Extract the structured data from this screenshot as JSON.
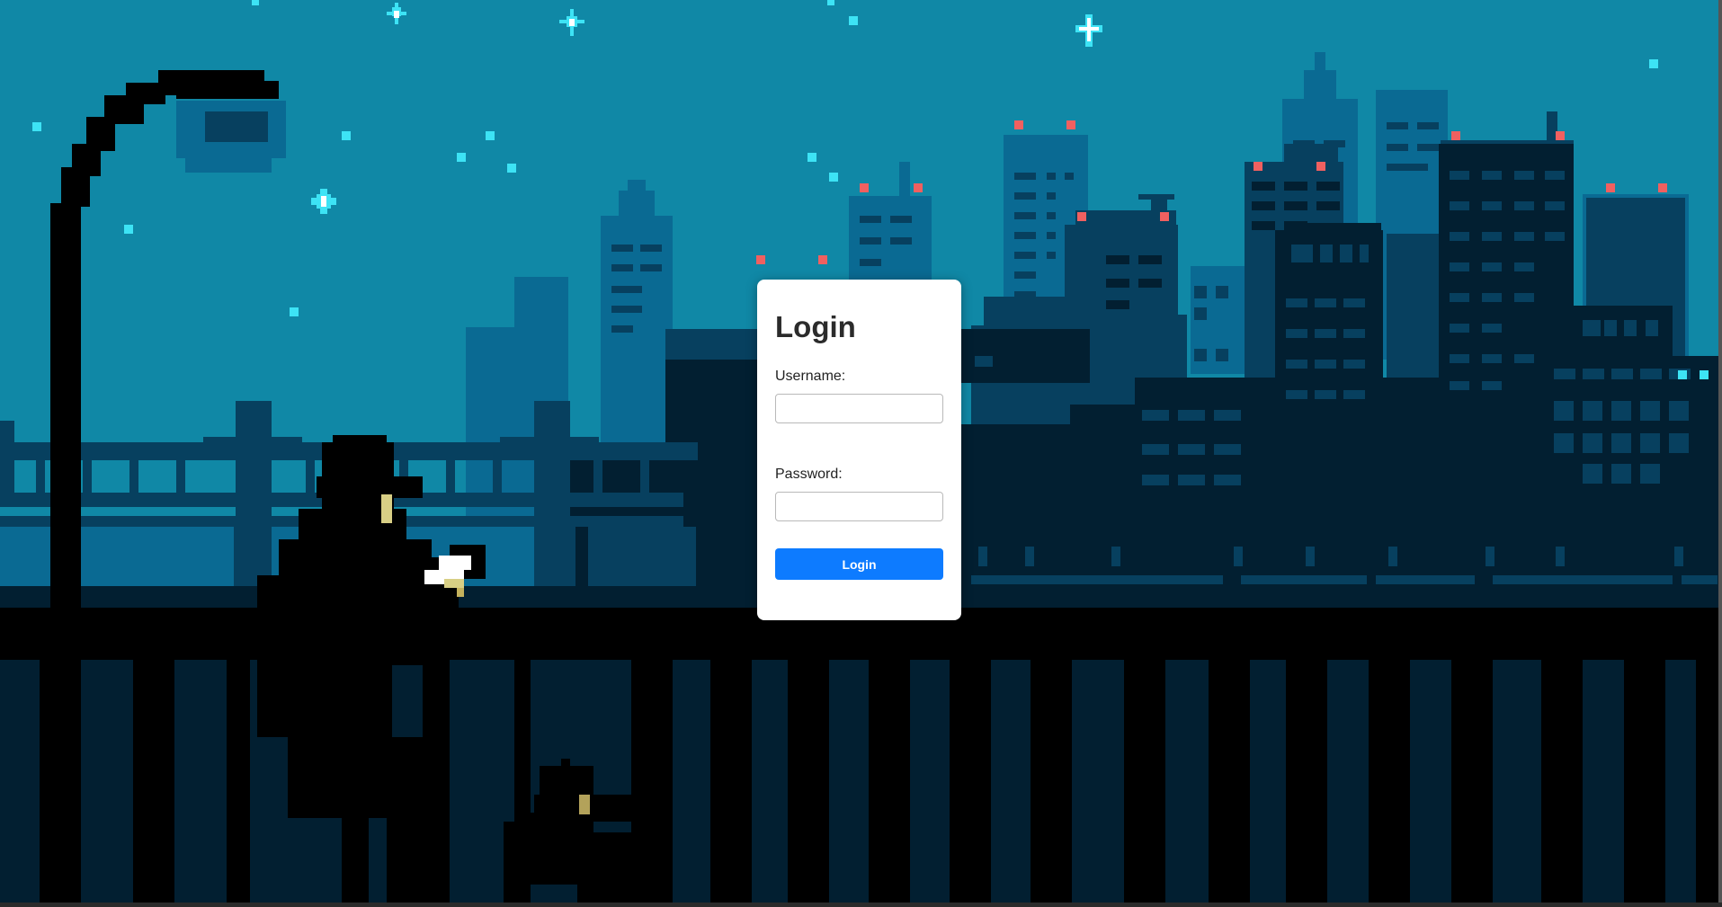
{
  "page": {
    "background_scene": "pixel-art night city skyline with bridge, street lamp, person and dog behind railing"
  },
  "colors": {
    "sky": "#1088a6",
    "building_mid": "#0a6a93",
    "building_dark": "#07405f",
    "building_darkest": "#021f31",
    "window_light": "#0d80aa",
    "antenna_light": "#f06060",
    "star": "#3de3f5",
    "accent_button": "#0d7bff"
  },
  "login": {
    "title": "Login",
    "username_label": "Username:",
    "username_value": "",
    "password_label": "Password:",
    "password_value": "",
    "button_label": "Login"
  }
}
